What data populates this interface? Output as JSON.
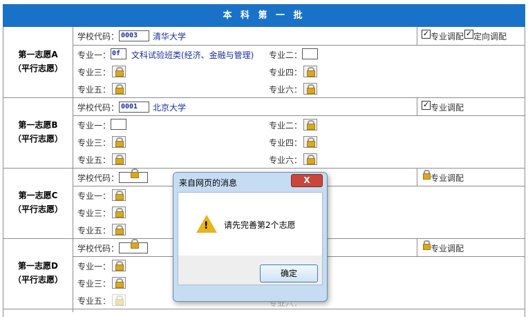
{
  "header": {
    "title": "本 科 第 一 批"
  },
  "groups": [
    {
      "title": "第一志愿A",
      "subtitle": "（平行志愿）",
      "school_label": "学校代码：",
      "school_code": "0003",
      "school_name": "清华大学",
      "options": [
        {
          "label": "专业调配",
          "checked": true
        },
        {
          "label": "定向调配",
          "checked": true
        }
      ],
      "majors": [
        {
          "label": "专业一：",
          "value": "0f",
          "name": "文科试验班类(经济、金融与管理)"
        },
        {
          "label": "专业二：",
          "value": ""
        },
        {
          "label": "专业三：",
          "locked": true
        },
        {
          "label": "专业四：",
          "locked": true
        },
        {
          "label": "专业五：",
          "locked": true
        },
        {
          "label": "专业六：",
          "locked": true
        }
      ]
    },
    {
      "title": "第一志愿B",
      "subtitle": "（平行志愿）",
      "school_label": "学校代码：",
      "school_code": "0001",
      "school_name": "北京大学",
      "options": [
        {
          "label": "专业调配",
          "checked": true
        }
      ],
      "majors": [
        {
          "label": "专业一：",
          "value": ""
        },
        {
          "label": "专业二：",
          "locked": true
        },
        {
          "label": "专业三：",
          "locked": true
        },
        {
          "label": "专业四：",
          "locked": true
        },
        {
          "label": "专业五：",
          "locked": true
        },
        {
          "label": "专业六：",
          "locked": true
        }
      ]
    },
    {
      "title": "第一志愿C",
      "subtitle": "（平行志愿）",
      "school_label": "学校代码：",
      "options": [
        {
          "label": "专业调配",
          "locked": true
        }
      ],
      "majors": [
        {
          "label": "专业一：",
          "locked": true
        },
        {
          "label": "专业三：",
          "locked": true
        },
        {
          "label": "专业五：",
          "locked": true
        }
      ]
    },
    {
      "title": "第一志愿D",
      "subtitle": "（平行志愿）",
      "school_label": "学校代码：",
      "options": [
        {
          "label": "专业调配",
          "locked": true
        }
      ],
      "majors": [
        {
          "label": "专业一：",
          "locked": true
        },
        {
          "label": "专业三：",
          "locked": true
        },
        {
          "label": "专业五：",
          "locked": true
        },
        {
          "label": "专业六：",
          "locked": true
        }
      ]
    }
  ],
  "dialog": {
    "title": "来自网页的消息",
    "close_label": "X",
    "message": "请先完善第2个志愿",
    "ok_label": "确定",
    "icon": "warning-icon"
  }
}
